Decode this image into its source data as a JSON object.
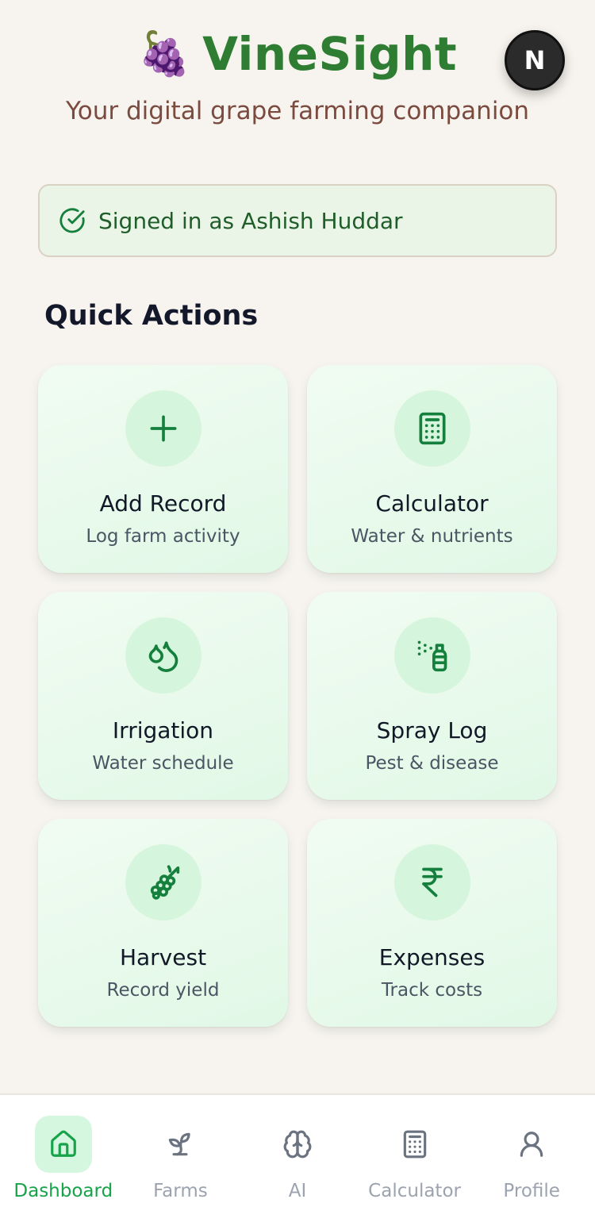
{
  "header": {
    "emoji": "🍇",
    "title": "VineSight",
    "tagline": "Your digital grape farming companion"
  },
  "user": {
    "avatar_initial": "N",
    "signed_in_text": "Signed in as Ashish Huddar"
  },
  "quick_actions": {
    "title": "Quick Actions",
    "items": [
      {
        "title": "Add Record",
        "subtitle": "Log farm activity",
        "icon": "plus-icon"
      },
      {
        "title": "Calculator",
        "subtitle": "Water & nutrients",
        "icon": "calculator-icon"
      },
      {
        "title": "Irrigation",
        "subtitle": "Water schedule",
        "icon": "droplets-icon"
      },
      {
        "title": "Spray Log",
        "subtitle": "Pest & disease",
        "icon": "spray-bottle-icon"
      },
      {
        "title": "Harvest",
        "subtitle": "Record yield",
        "icon": "grape-icon"
      },
      {
        "title": "Expenses",
        "subtitle": "Track costs",
        "icon": "rupee-icon"
      }
    ]
  },
  "bottom_nav": {
    "items": [
      {
        "label": "Dashboard",
        "icon": "home-icon",
        "active": true
      },
      {
        "label": "Farms",
        "icon": "sprout-icon",
        "active": false
      },
      {
        "label": "AI",
        "icon": "brain-icon",
        "active": false
      },
      {
        "label": "Calculator",
        "icon": "calculator-icon",
        "active": false
      },
      {
        "label": "Profile",
        "icon": "user-icon",
        "active": false
      }
    ]
  },
  "colors": {
    "brand_green": "#2f7d32",
    "icon_green": "#15803d",
    "active_nav": "#16a34a",
    "tagline_brown": "#7a4b3e",
    "background": "#f7f4ef"
  }
}
